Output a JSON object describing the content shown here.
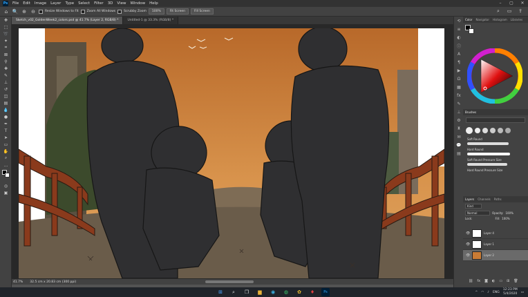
{
  "app": {
    "title": "Adobe Photoshop",
    "logo": "Ps"
  },
  "menu": [
    "File",
    "Edit",
    "Image",
    "Layer",
    "Type",
    "Select",
    "Filter",
    "3D",
    "View",
    "Window",
    "Help"
  ],
  "options_bar": {
    "resize_windows": "Resize Windows to Fit",
    "zoom_all_windows": "Zoom All Windows",
    "scrubby_zoom": "Scrubby Zoom",
    "zoom_100": "100%",
    "fit_screen": "Fit Screen",
    "fill_screen": "Fill Screen"
  },
  "tabs": [
    {
      "label": "Sketch_v02_GoldenWeek2_colors.psd @ 41.7% (Layer 2, RGB/8) *",
      "active": true
    },
    {
      "label": "Untitled-1 @ 33.3% (RGB/8) *",
      "active": false
    }
  ],
  "status": {
    "zoom": "41.7%",
    "doc_size": "32.5 cm x 20.83 cm (300 ppi)"
  },
  "color_panel": {
    "tabs": [
      "Color",
      "Navigator",
      "Histogram",
      "Libraries"
    ],
    "active": "Color"
  },
  "brushes_panel": {
    "title": "Brushes",
    "presets": [
      "Soft Round",
      "Hard Round",
      "Soft Round Pressure Size",
      "Hard Round Pressure Size"
    ]
  },
  "layers_panel": {
    "tabs": [
      "Layers",
      "Channels",
      "Paths"
    ],
    "kind": "Kind",
    "blend_mode": "Normal",
    "opacity_label": "Opacity:",
    "opacity": "100%",
    "lock_label": "Lock:",
    "fill_label": "Fill:",
    "fill": "100%",
    "layers": [
      {
        "name": "Layer 4",
        "selected": false
      },
      {
        "name": "Layer 1",
        "selected": false
      },
      {
        "name": "Layer 2",
        "selected": true
      }
    ]
  },
  "taskbar": {
    "lang": "ENG",
    "time": "12:23 PM",
    "date": "5/4/2020"
  },
  "colors": {
    "sky": "#c97b35",
    "accent": "#31a8ff",
    "railing": "#8a3a1c"
  }
}
